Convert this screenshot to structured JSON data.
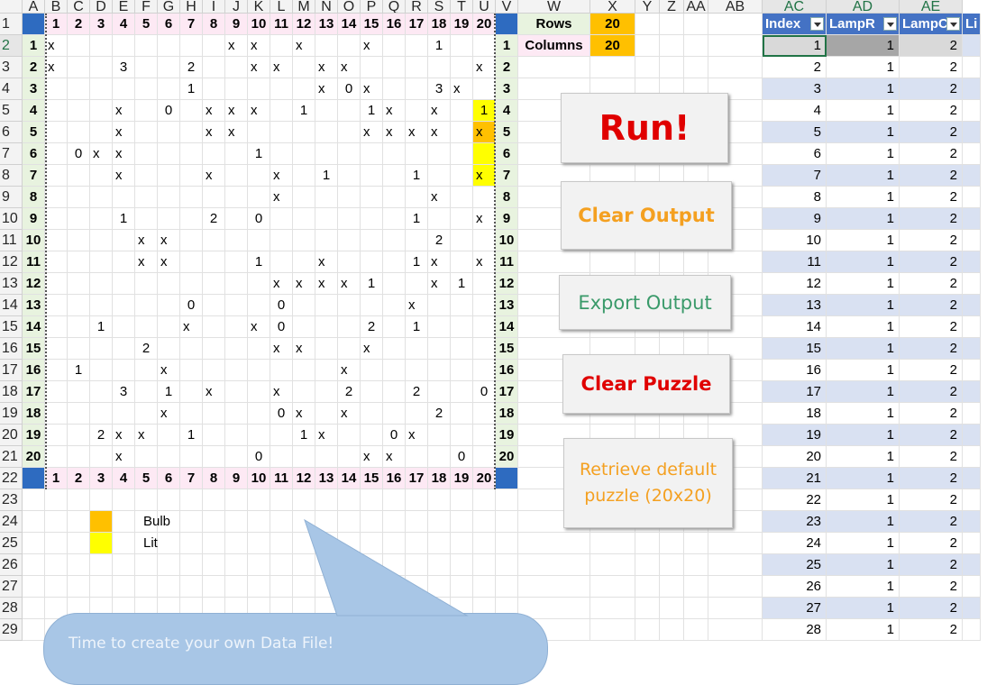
{
  "columns": [
    "A",
    "B",
    "C",
    "D",
    "E",
    "F",
    "G",
    "H",
    "I",
    "J",
    "K",
    "L",
    "M",
    "N",
    "O",
    "P",
    "Q",
    "R",
    "S",
    "T",
    "U",
    "V",
    "W",
    "X",
    "Y",
    "Z",
    "AA",
    "AB",
    "AC",
    "AD",
    "AE"
  ],
  "row_numbers": [
    "1",
    "2",
    "3",
    "4",
    "5",
    "6",
    "7",
    "8",
    "9",
    "10",
    "11",
    "12",
    "13",
    "14",
    "15",
    "16",
    "17",
    "18",
    "19",
    "20",
    "21",
    "22",
    "23",
    "24",
    "25",
    "26",
    "27",
    "28",
    "29"
  ],
  "puzzle": {
    "col_labels": [
      "1",
      "2",
      "3",
      "4",
      "5",
      "6",
      "7",
      "8",
      "9",
      "10",
      "11",
      "12",
      "13",
      "14",
      "15",
      "16",
      "17",
      "18",
      "19",
      "20"
    ],
    "row_labels": [
      "1",
      "2",
      "3",
      "4",
      "5",
      "6",
      "7",
      "8",
      "9",
      "10",
      "11",
      "12",
      "13",
      "14",
      "15",
      "16",
      "17",
      "18",
      "19",
      "20"
    ],
    "grid": [
      [
        "x",
        "",
        "",
        "",
        "",
        "",
        "",
        "",
        "x",
        "x",
        "",
        "x",
        "",
        "",
        "x",
        "",
        "",
        "1",
        "",
        ""
      ],
      [
        "x",
        "",
        "",
        "3",
        "",
        "",
        "2",
        "",
        "",
        "x",
        "x",
        "",
        "x",
        "x",
        "",
        "",
        "",
        "",
        "",
        "x",
        "1"
      ],
      [
        "",
        "",
        "",
        "",
        "",
        "",
        "1",
        "",
        "",
        "",
        "",
        "",
        "x",
        "0",
        "x",
        "",
        "",
        "3",
        "x",
        "",
        ""
      ],
      [
        "",
        "",
        "",
        "x",
        "",
        "0",
        "",
        "x",
        "x",
        "x",
        "",
        "1",
        "",
        "",
        "1",
        "x",
        "",
        "x",
        "",
        "1",
        ""
      ],
      [
        "",
        "",
        "",
        "x",
        "",
        "",
        "",
        "x",
        "x",
        "",
        "",
        "",
        "",
        "",
        "x",
        "x",
        "x",
        "x",
        "",
        "x",
        ""
      ],
      [
        "",
        "0",
        "x",
        "x",
        "",
        "",
        "",
        "",
        "",
        "1",
        "",
        "",
        "",
        "",
        "",
        "",
        "",
        "",
        "",
        "",
        ""
      ],
      [
        "",
        "",
        "",
        "x",
        "",
        "",
        "",
        "x",
        "",
        "",
        "x",
        "",
        "1",
        "",
        "",
        "",
        "1",
        "",
        "",
        "x",
        ""
      ],
      [
        "",
        "",
        "",
        "",
        "",
        "",
        "",
        "",
        "",
        "",
        "x",
        "",
        "",
        "",
        "",
        "",
        "",
        "x",
        "",
        "",
        "0"
      ],
      [
        "",
        "",
        "",
        "1",
        "",
        "",
        "",
        "2",
        "",
        "0",
        "",
        "",
        "",
        "",
        "",
        "",
        "1",
        "",
        "",
        "x",
        "1"
      ],
      [
        "",
        "",
        "",
        "",
        "x",
        "x",
        "",
        "",
        "",
        "",
        "",
        "",
        "",
        "",
        "",
        "",
        "",
        "2",
        "",
        "",
        ""
      ],
      [
        "",
        "",
        "",
        "",
        "x",
        "x",
        "",
        "",
        "",
        "1",
        "",
        "",
        "x",
        "",
        "",
        "",
        "1",
        "x",
        "",
        "x",
        "1"
      ],
      [
        "",
        "",
        "",
        "",
        "",
        "",
        "",
        "",
        "",
        "",
        "x",
        "x",
        "x",
        "x",
        "1",
        "",
        "",
        "x",
        "1",
        "",
        ""
      ],
      [
        "",
        "",
        "",
        "",
        "",
        "",
        "0",
        "",
        "",
        "",
        "0",
        "",
        "",
        "",
        "",
        "",
        "x",
        "",
        "",
        "",
        "x"
      ],
      [
        "",
        "",
        "1",
        "",
        "",
        "",
        "x",
        "",
        "",
        "x",
        "0",
        "",
        "",
        "",
        "2",
        "",
        "1",
        "",
        "",
        "",
        ""
      ],
      [
        "",
        "",
        "",
        "",
        "2",
        "",
        "",
        "",
        "",
        "",
        "x",
        "x",
        "",
        "",
        "x",
        "",
        "",
        "",
        "",
        "",
        ""
      ],
      [
        "",
        "1",
        "",
        "",
        "",
        "x",
        "",
        "",
        "",
        "",
        "",
        "",
        "",
        "x",
        "",
        "",
        "",
        "",
        "",
        "",
        ""
      ],
      [
        "",
        "",
        "",
        "3",
        "",
        "1",
        "",
        "x",
        "",
        "",
        "x",
        "",
        "",
        "2",
        "",
        "",
        "2",
        "",
        "",
        "0",
        ""
      ],
      [
        "",
        "",
        "",
        "",
        "",
        "x",
        "",
        "",
        "",
        "",
        "0",
        "x",
        "",
        "x",
        "",
        "",
        "",
        "2",
        "",
        "",
        ""
      ],
      [
        "",
        "",
        "2",
        "x",
        "x",
        "",
        "1",
        "",
        "",
        "",
        "",
        "1",
        "x",
        "",
        "",
        "0",
        "x",
        "",
        "",
        "",
        ""
      ],
      [
        "",
        "",
        "",
        "x",
        "",
        "",
        "",
        "",
        "",
        "0",
        "",
        "",
        "",
        "",
        "x",
        "x",
        "",
        "",
        "0",
        "",
        "x"
      ]
    ]
  },
  "info": {
    "rows_label": "Rows",
    "rows_value": "20",
    "cols_label": "Columns",
    "cols_value": "20"
  },
  "legend": [
    {
      "label": "Bulb",
      "color": "#ffc000"
    },
    {
      "label": "Lit",
      "color": "#ffff00"
    }
  ],
  "buttons": {
    "run": {
      "label": "Run!",
      "color": "#e00000"
    },
    "clear_output": {
      "label": "Clear Output",
      "color": "#f4a020"
    },
    "export_output": {
      "label": "Export Output",
      "color": "#3a9a6a"
    },
    "clear_puzzle": {
      "label": "Clear Puzzle",
      "color": "#e00000"
    },
    "retrieve_default": {
      "label": "Retrieve default puzzle (20x20)",
      "color": "#f4a020"
    }
  },
  "table": {
    "headers": [
      "Index",
      "LampR",
      "LampC",
      "Li"
    ],
    "rows": [
      [
        "1",
        "1",
        "2"
      ],
      [
        "2",
        "1",
        "2"
      ],
      [
        "3",
        "1",
        "2"
      ],
      [
        "4",
        "1",
        "2"
      ],
      [
        "5",
        "1",
        "2"
      ],
      [
        "6",
        "1",
        "2"
      ],
      [
        "7",
        "1",
        "2"
      ],
      [
        "8",
        "1",
        "2"
      ],
      [
        "9",
        "1",
        "2"
      ],
      [
        "10",
        "1",
        "2"
      ],
      [
        "11",
        "1",
        "2"
      ],
      [
        "12",
        "1",
        "2"
      ],
      [
        "13",
        "1",
        "2"
      ],
      [
        "14",
        "1",
        "2"
      ],
      [
        "15",
        "1",
        "2"
      ],
      [
        "16",
        "1",
        "2"
      ],
      [
        "17",
        "1",
        "2"
      ],
      [
        "18",
        "1",
        "2"
      ],
      [
        "19",
        "1",
        "2"
      ],
      [
        "20",
        "1",
        "2"
      ],
      [
        "21",
        "1",
        "2"
      ],
      [
        "22",
        "1",
        "2"
      ],
      [
        "23",
        "1",
        "2"
      ],
      [
        "24",
        "1",
        "2"
      ],
      [
        "25",
        "1",
        "2"
      ],
      [
        "26",
        "1",
        "2"
      ],
      [
        "27",
        "1",
        "2"
      ],
      [
        "28",
        "1",
        "2"
      ]
    ]
  },
  "callout": {
    "text": "Time to create your own Data File!"
  }
}
